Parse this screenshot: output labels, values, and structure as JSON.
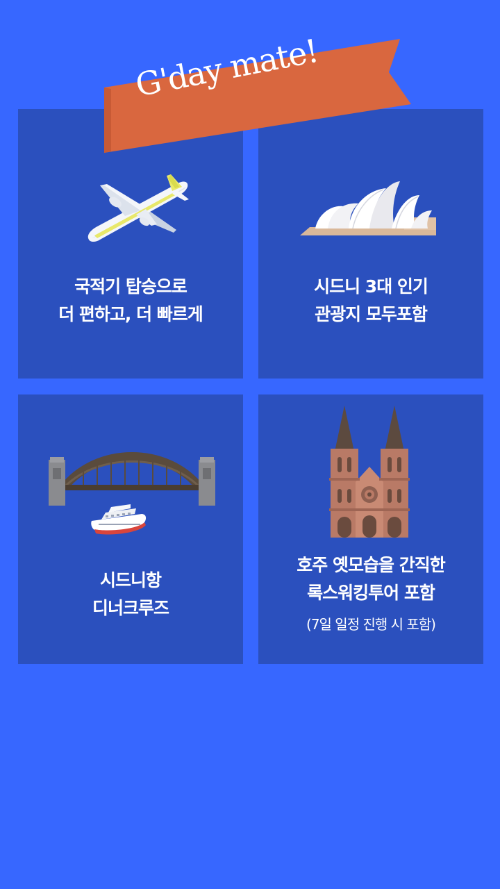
{
  "banner": {
    "text": "G'day mate!",
    "color": "#D9673F"
  },
  "colors": {
    "background": "#3767FF",
    "card": "#2B50BE",
    "text": "#FFFFFF"
  },
  "cards": [
    {
      "icon": "airplane-icon",
      "lines": [
        "국적기 탑승으로",
        "더 편하고, 더 빠르게"
      ]
    },
    {
      "icon": "sydney-opera-house-icon",
      "lines": [
        "시드니 3대 인기",
        "관광지 모두포함"
      ]
    },
    {
      "icon": "harbour-bridge-cruise-icon",
      "lines": [
        "시드니항",
        "디너크루즈"
      ]
    },
    {
      "icon": "cathedral-icon",
      "lines": [
        "호주 옛모습을 간직한",
        "록스워킹투어 포함"
      ],
      "note": "(7일 일정 진행 시 포함)"
    }
  ]
}
